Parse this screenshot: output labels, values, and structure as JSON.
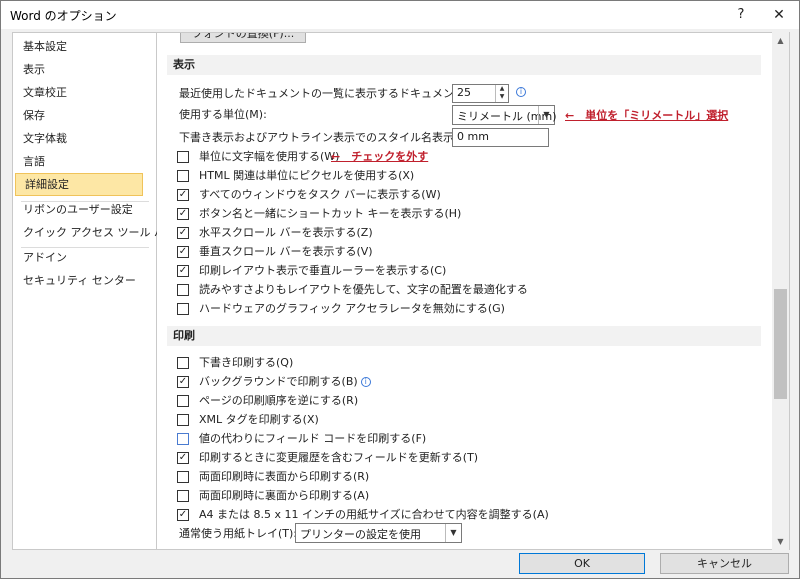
{
  "window": {
    "title": "Word のオプション",
    "help": "?",
    "close": "✕"
  },
  "sidebar": {
    "items": [
      {
        "label": "基本設定"
      },
      {
        "label": "表示"
      },
      {
        "label": "文章校正"
      },
      {
        "label": "保存"
      },
      {
        "label": "文字体裁"
      },
      {
        "label": "言語"
      },
      {
        "label": "詳細設定",
        "selected": true
      },
      {
        "label": "リボンのユーザー設定"
      },
      {
        "label": "クイック アクセス ツール バー"
      },
      {
        "label": "アドイン"
      },
      {
        "label": "セキュリティ センター"
      }
    ]
  },
  "content": {
    "font_button": "フォントの置換(F)...",
    "display": {
      "header": "表示",
      "recent_docs_label": "最近使用したドキュメントの一覧に表示するドキュメントの数(R):",
      "recent_docs_value": "25",
      "units_label": "使用する単位(M):",
      "units_value": "ミリメートル (mm)",
      "style_width_label": "下書き表示およびアウトライン表示でのスタイル名表示領域(E):",
      "style_width_value": "0 mm",
      "checkboxes": [
        {
          "label": "単位に文字幅を使用する(W)",
          "checked": false
        },
        {
          "label": "HTML 関連は単位にピクセルを使用する(X)",
          "checked": false
        },
        {
          "label": "すべてのウィンドウをタスク バーに表示する(W)",
          "checked": true
        },
        {
          "label": "ボタン名と一緒にショートカット キーを表示する(H)",
          "checked": true
        },
        {
          "label": "水平スクロール バーを表示する(Z)",
          "checked": true
        },
        {
          "label": "垂直スクロール バーを表示する(V)",
          "checked": true
        },
        {
          "label": "印刷レイアウト表示で垂直ルーラーを表示する(C)",
          "checked": true
        },
        {
          "label": "読みやすさよりもレイアウトを優先して、文字の配置を最適化する",
          "checked": false
        },
        {
          "label": "ハードウェアのグラフィック アクセラレータを無効にする(G)",
          "checked": false
        }
      ]
    },
    "print": {
      "header": "印刷",
      "checkboxes": [
        {
          "label": "下書き印刷する(Q)",
          "checked": false
        },
        {
          "label": "バックグラウンドで印刷する(B)",
          "checked": true,
          "info": true
        },
        {
          "label": "ページの印刷順序を逆にする(R)",
          "checked": false
        },
        {
          "label": "XML タグを印刷する(X)",
          "checked": false
        },
        {
          "label": "値の代わりにフィールド コードを印刷する(F)",
          "checked": false
        },
        {
          "label": "印刷するときに変更履歴を含むフィールドを更新する(T)",
          "checked": true
        },
        {
          "label": "両面印刷時に表面から印刷する(R)",
          "checked": false
        },
        {
          "label": "両面印刷時に裏面から印刷する(A)",
          "checked": false
        },
        {
          "label": "A4 または 8.5 x 11 インチの用紙サイズに合わせて内容を調整する(A)",
          "checked": true
        }
      ],
      "tray_label": "通常使う用紙トレイ(T):",
      "tray_value": "プリンターの設定を使用"
    },
    "annotations": {
      "units": "←　単位を「ミリメートル」選択",
      "uncheck": "←　チェックを外す"
    }
  },
  "buttons": {
    "ok": "OK",
    "cancel": "キャンセル"
  },
  "colors": {
    "selected_bg": "#fde7a5",
    "annotation": "#c0202d",
    "ok_border": "#0078d7"
  }
}
